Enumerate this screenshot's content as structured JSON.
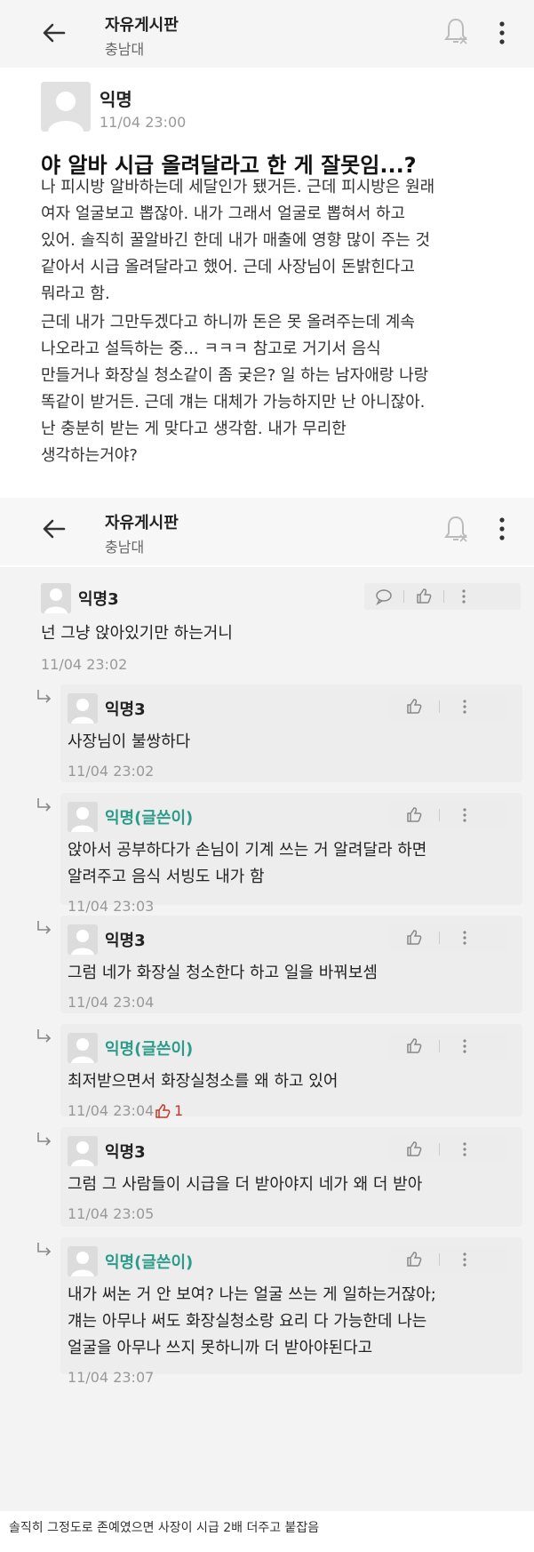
{
  "header": {
    "title": "자유게시판",
    "subtitle": "충남대"
  },
  "post": {
    "author": "익명",
    "time": "11/04 23:00",
    "title": "야 알바 시급 올려달라고 한 게 잘못임...?",
    "paragraph1": "나 피시방 알바하는데 세달인가 됐거든. 근데 피시방은 원래\n여자 얼굴보고 뽑잖아. 내가 그래서 얼굴로 뽑혀서 하고\n있어. 솔직히 꿀알바긴 한데 내가 매출에 영향 많이 주는 것\n같아서 시급 올려달라고 했어. 근데 사장님이 돈밝힌다고\n뭐라고 함.",
    "paragraph2": "근데 내가 그만두겠다고 하니까 돈은 못 올려주는데 계속\n나오라고 설득하는 중... ㅋㅋㅋ 참고로 거기서 음식\n만들거나 화장실 청소같이 좀 궂은? 일 하는 남자애랑 나랑\n똑같이 받거든. 근데 걔는 대체가 가능하지만 난 아니잖아.\n난 충분히 받는 게 맞다고 생각함. 내가 무리한\n생각하는거야?"
  },
  "top_comment": {
    "author": "익명3",
    "text": "넌 그냥 앉아있기만 하는거니",
    "time": "11/04 23:02"
  },
  "replies": [
    {
      "author": "익명3",
      "writer": false,
      "text": "사장님이 불쌍하다",
      "time": "11/04 23:02",
      "likes": ""
    },
    {
      "author": "익명(글쓴이)",
      "writer": true,
      "text": "앉아서 공부하다가 손님이 기계 쓰는 거 알려달라 하면\n알려주고 음식 서빙도 내가 함",
      "time": "11/04 23:03",
      "likes": ""
    },
    {
      "author": "익명3",
      "writer": false,
      "text": "그럼 네가 화장실 청소한다 하고 일을 바꿔보셈",
      "time": "11/04 23:04",
      "likes": ""
    },
    {
      "author": "익명(글쓴이)",
      "writer": true,
      "text": "최저받으면서 화장실청소를 왜 하고 있어",
      "time": "11/04 23:04",
      "likes": "1"
    },
    {
      "author": "익명3",
      "writer": false,
      "text": "그럼 그 사람들이 시급을 더 받아야지 네가 왜 더 받아",
      "time": "11/04 23:05",
      "likes": ""
    },
    {
      "author": "익명(글쓴이)",
      "writer": true,
      "text": "내가 써논 거 안 보여? 나는 얼굴 쓰는 게 일하는거잖아;\n걔는 아무나 써도 화장실청소랑 요리 다 가능한데 나는\n얼굴을 아무나 쓰지 못하니까 더 받아야된다고",
      "time": "11/04 23:07",
      "likes": ""
    }
  ],
  "caption": "솔직히 그정도로 존예였으면 사장이 시급 2배 더주고 붙잡음",
  "colors": {
    "writer_accent": "#2c9c8a",
    "like_accent": "#c0392b",
    "comment_bg": "#f3f3f3"
  }
}
